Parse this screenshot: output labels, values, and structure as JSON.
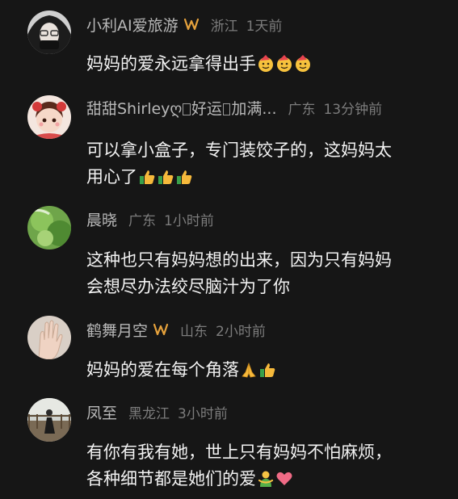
{
  "comments": [
    {
      "user": "小利AI爱旅游",
      "location": "浙江",
      "time": "1天前",
      "lines": [
        "妈妈的爱永远拿得出手"
      ],
      "emojis": [
        "face-party-icon",
        "face-party-icon",
        "face-party-icon"
      ],
      "has_badge": true
    },
    {
      "user_parts": [
        "甜甜Shirleyღ",
        "好运",
        "加满..."
      ],
      "location": "广东",
      "time": "13分钟前",
      "lines": [
        "可以拿小盒子，专门装饺子的，这妈妈太",
        "用心了"
      ],
      "emojis": [
        "thumbs-up-icon",
        "thumbs-up-icon",
        "thumbs-up-icon"
      ],
      "has_badge": false
    },
    {
      "user": "晨晓",
      "location": "广东",
      "time": "1小时前",
      "lines": [
        "这种也只有妈妈想的出来，因为只有妈妈",
        "会想尽办法绞尽脑汁为了你"
      ],
      "emojis": [],
      "has_badge": false
    },
    {
      "user": "鹤舞月空",
      "location": "山东",
      "time": "2小时前",
      "lines": [
        "妈妈的爱在每个角落"
      ],
      "emojis": [
        "folded-hands-icon",
        "thumbs-up-icon"
      ],
      "has_badge": true
    },
    {
      "user": "凤至",
      "location": "黑龙江",
      "time": "3小时前",
      "lines": [
        "有你有我有她，世上只有妈妈不怕麻烦，",
        "各种细节都是她们的爱"
      ],
      "emojis": [
        "hugging-figure-icon",
        "heart-icon"
      ],
      "has_badge": false
    }
  ],
  "colors": {
    "background": "#161616",
    "username": "#b8b8b8",
    "meta": "#7c7c7c",
    "text": "#f2f2f2",
    "badge": "#e6a23c"
  }
}
